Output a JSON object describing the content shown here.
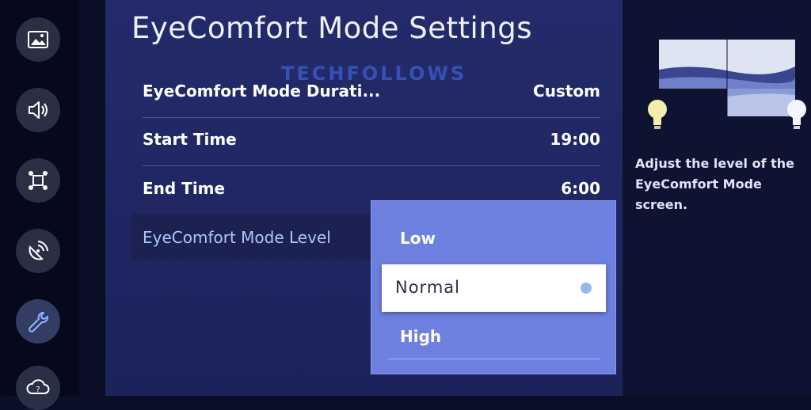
{
  "panel": {
    "title": "EyeComfort Mode Settings",
    "watermark": "TECHFOLLOWS"
  },
  "rows": [
    {
      "label": "EyeComfort Mode Durati...",
      "value": "Custom"
    },
    {
      "label": "Start Time",
      "value": "19:00"
    },
    {
      "label": "End Time",
      "value": "6:00"
    },
    {
      "label": "EyeComfort Mode Level",
      "value": ""
    }
  ],
  "dropdown": {
    "options": [
      {
        "label": "Low"
      },
      {
        "label": "Normal",
        "selected": true
      },
      {
        "label": "High"
      }
    ]
  },
  "help": {
    "text": "Adjust the level of the EyeComfort Mode screen."
  },
  "sidebar": {
    "icons": [
      "picture-icon",
      "sound-icon",
      "connection-icon",
      "broadcast-icon",
      "wrench-icon",
      "support-icon"
    ]
  },
  "colors": {
    "panel_bg": "#232b6a",
    "dropdown_bg": "#6d80df",
    "highlight_text": "#aec6ff"
  }
}
